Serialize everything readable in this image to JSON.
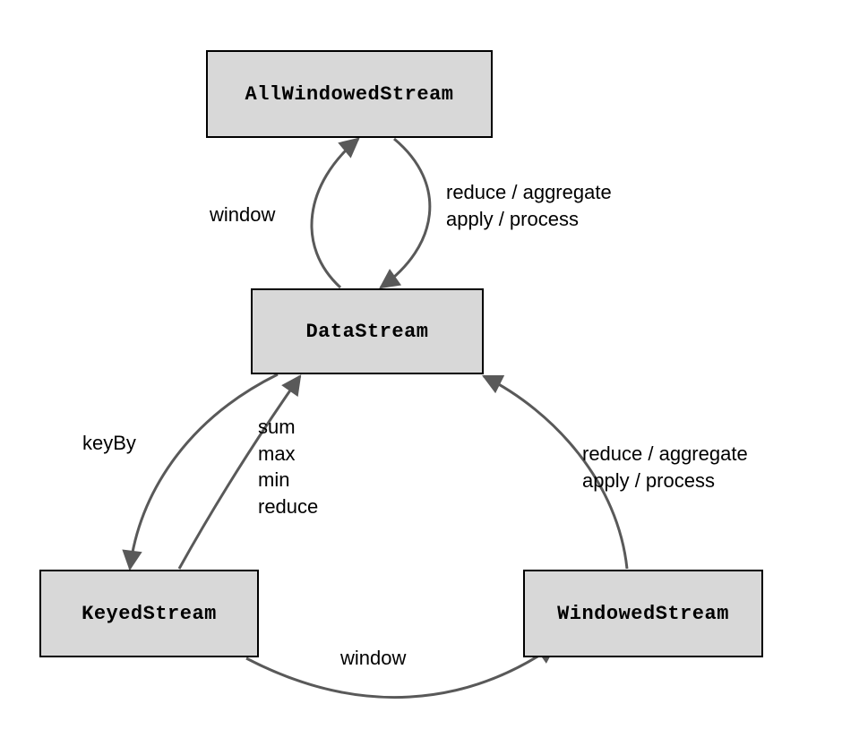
{
  "nodes": {
    "allWindowed": {
      "label": "AllWindowedStream"
    },
    "dataStream": {
      "label": "DataStream"
    },
    "keyedStream": {
      "label": "KeyedStream"
    },
    "windowedStream": {
      "label": "WindowedStream"
    }
  },
  "edges": {
    "ds_to_allw": {
      "label": "window"
    },
    "allw_to_ds": {
      "label": "reduce / aggregate\napply / process"
    },
    "ds_to_keyed": {
      "label": "keyBy"
    },
    "keyed_to_ds": {
      "label": "sum\nmax\nmin\nreduce"
    },
    "keyed_to_win": {
      "label": "window"
    },
    "win_to_ds": {
      "label": "reduce / aggregate\napply / process"
    }
  },
  "style": {
    "node_fill": "#d8d8d8",
    "node_stroke": "#000000",
    "arrow_stroke": "#595959"
  }
}
